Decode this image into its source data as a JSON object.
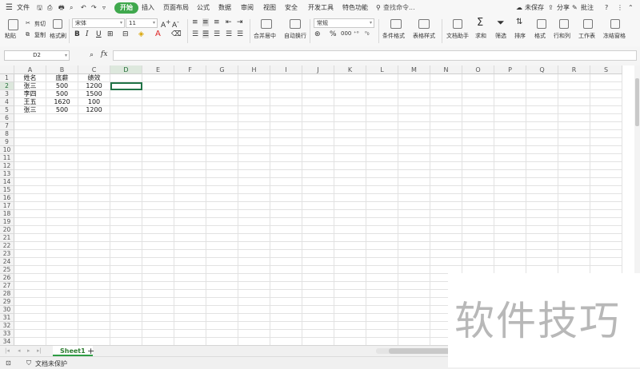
{
  "menubar": {
    "menu_icon": "hamburger-icon",
    "file": "文件",
    "tabs": [
      "开始",
      "插入",
      "页面布局",
      "公式",
      "数据",
      "审阅",
      "视图",
      "安全",
      "开发工具",
      "特色功能"
    ],
    "active_tab": "开始",
    "search": "查找命令...",
    "unsaved": "未保存",
    "share": "分享",
    "comment": "批注"
  },
  "ribbon": {
    "paste": "粘贴",
    "cut": "剪切",
    "copy": "复制",
    "format_painter": "格式刷",
    "font_name": "宋体",
    "font_size": "11",
    "merge_center": "合并居中",
    "wrap_text": "自动换行",
    "number_format": "常规",
    "conditional_format": "条件格式",
    "table_style": "表格样式",
    "doc_assistant": "文档助手",
    "sum": "求和",
    "filter": "筛选",
    "sort": "排序",
    "format": "格式",
    "row_col": "行和列",
    "worksheet": "工作表",
    "freeze": "冻结窗格"
  },
  "formula_bar": {
    "name_box": "D2",
    "fx": "fx",
    "formula": ""
  },
  "sheet": {
    "columns": [
      "A",
      "B",
      "C",
      "D",
      "E",
      "F",
      "G",
      "H",
      "I",
      "J",
      "K",
      "L",
      "M",
      "N",
      "O",
      "P",
      "Q",
      "R",
      "S"
    ],
    "rows": [
      "1",
      "2",
      "3",
      "4",
      "5",
      "6",
      "7",
      "8",
      "9",
      "10",
      "11",
      "12",
      "13",
      "14",
      "15",
      "16",
      "17",
      "18",
      "19",
      "20",
      "21",
      "22",
      "23",
      "24",
      "25",
      "26",
      "27",
      "28",
      "29",
      "30",
      "31",
      "32",
      "33",
      "34"
    ],
    "data": [
      [
        "姓名",
        "底薪",
        "绩效"
      ],
      [
        "张三",
        "500",
        "1200"
      ],
      [
        "李四",
        "500",
        "1500"
      ],
      [
        "王五",
        "1620",
        "100"
      ],
      [
        "张三",
        "500",
        "1200"
      ]
    ],
    "selected_cell": "D2"
  },
  "tabs": {
    "sheet1": "Sheet1",
    "add": "+"
  },
  "status": {
    "protect": "文档未保护"
  },
  "watermark": "软件技巧"
}
